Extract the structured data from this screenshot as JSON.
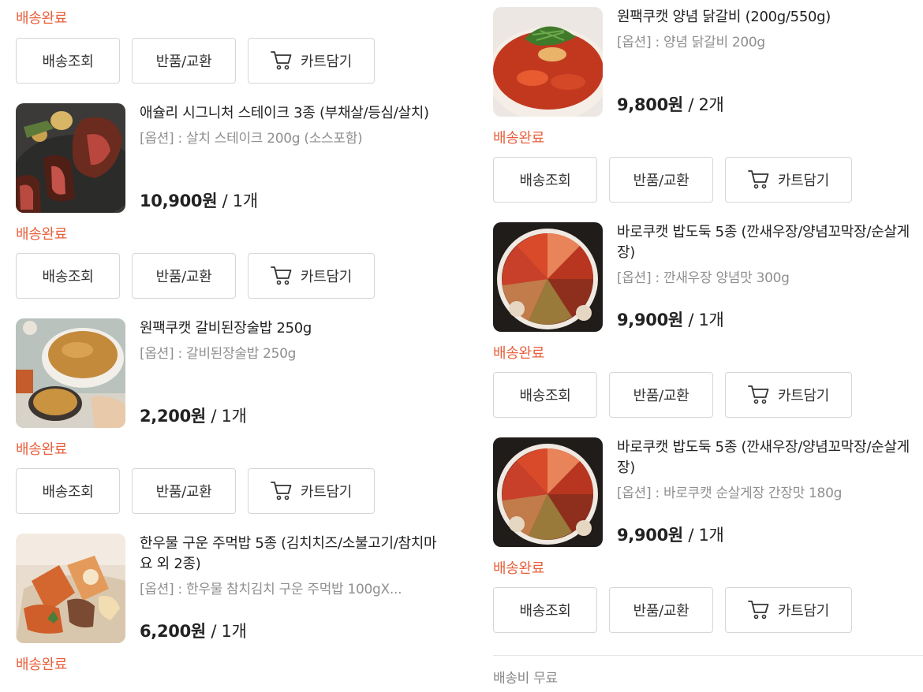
{
  "labels": {
    "status": "배송완료",
    "track_button": "배송조회",
    "return_button": "반품/교환",
    "cart_button": "카트담기",
    "separator": " / "
  },
  "left_items": [
    {
      "name": "애슐리 시그니처 스테이크 3종 (부채살/등심/살치)",
      "option": "[옵션] : 살치 스테이크 200g (소스포함)",
      "price": "10,900원",
      "qty": "1개"
    },
    {
      "name": "원팩쿠캣 갈비된장술밥 250g",
      "option": "[옵션] : 갈비된장술밥 250g",
      "price": "2,200원",
      "qty": "1개"
    },
    {
      "name": "한우물 구운 주먹밥 5종 (김치치즈/소불고기/참치마요 외 2종)",
      "option": "[옵션] : 한우물 참치김치 구운 주먹밥 100gX...",
      "price": "6,200원",
      "qty": "1개"
    }
  ],
  "right_items": [
    {
      "name": "원팩쿠캣 양념 닭갈비 (200g/550g)",
      "option": "[옵션] : 양념 닭갈비 200g",
      "price": "9,800원",
      "qty": "2개"
    },
    {
      "name": "바로쿠캣 밥도둑 5종 (깐새우장/양념꼬막장/순살게장)",
      "option": "[옵션] : 깐새우장 양념맛 300g",
      "price": "9,900원",
      "qty": "1개"
    },
    {
      "name": "바로쿠캣 밥도둑 5종 (깐새우장/양념꼬막장/순살게장)",
      "option": "[옵션] : 바로쿠캣 순살게장 간장맛 180g",
      "price": "9,900원",
      "qty": "1개"
    }
  ],
  "footer": {
    "shipping": "배송비 무료"
  },
  "colors": {
    "status": "#e8603c",
    "border": "#d6d6d6",
    "muted": "#8f8f8f"
  },
  "icons": {
    "cart": "shopping-cart-icon"
  }
}
